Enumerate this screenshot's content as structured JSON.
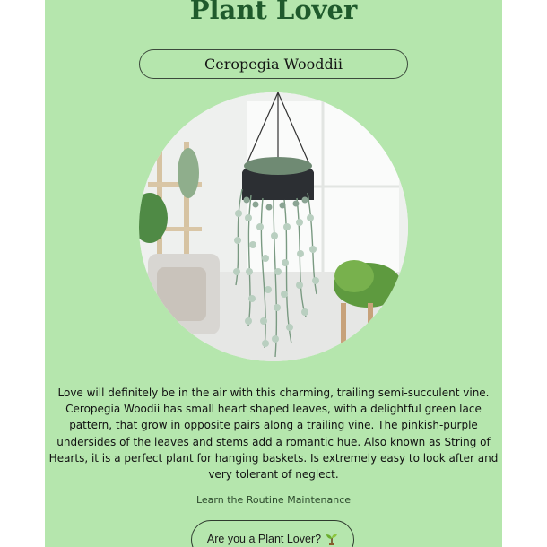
{
  "header": {
    "title": "Plant Lover"
  },
  "plant": {
    "name": "Ceropegia Wooddii",
    "description": "Love will definitely be in the air with this charming, trailing semi-succulent vine. Ceropegia Woodii has small heart shaped leaves, with a delightful green lace pattern, that grow in opposite pairs along a trailing vine. The pinkish-purple undersides of the leaves and stems add a romantic hue. Also known as String of Hearts, it is a perfect plant for hanging baskets. Is extremely easy to look after and very tolerant of neglect."
  },
  "links": {
    "maintenance": "Learn the Routine Maintenance"
  },
  "cta": {
    "label": "Are you a Plant Lover?",
    "icon": "sprout-icon"
  },
  "colors": {
    "background": "#b5e6ad",
    "title": "#1f5a2c"
  }
}
